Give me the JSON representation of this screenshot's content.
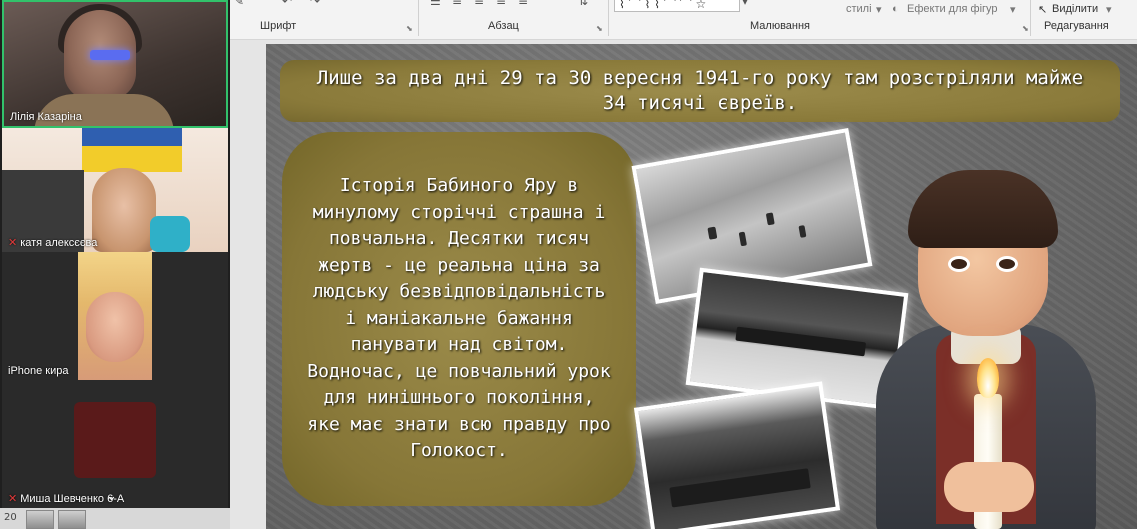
{
  "ribbon": {
    "group_font": "Шрифт",
    "group_paragraph": "Абзац",
    "group_drawing": "Малювання",
    "group_editing": "Редагування",
    "styles_label": "стилі",
    "shape_effects_label": "Ефекти для фігур",
    "select_label": "Виділити"
  },
  "participants": [
    {
      "name": "Лілія Казаріна",
      "muted": false,
      "active": true
    },
    {
      "name": "катя алексєєва",
      "muted": true
    },
    {
      "name": "iPhone кира",
      "muted": false
    },
    {
      "name": "Миша Шевченко 6-А",
      "muted": true
    }
  ],
  "slide": {
    "banner": "Лише за два дні 29 та 30 вересня 1941-го року там розстріляли майже 34 тисячі євреїв.",
    "story": "Історія Бабиного Яру в минулому сторіччі страшна і повчальна. Десятки тисяч жертв - це реальна ціна за людську безвідповідальність і маніакальне бажання панувати над світом. Водночас, це повчальний урок для нинішнього покоління, яке має знати всю правду про Голокост."
  },
  "thumbnail_numbers": [
    "20"
  ],
  "colors": {
    "active_speaker": "#32c26b",
    "text_panel": "#8a7a3a",
    "muted_icon": "#e03a3a"
  }
}
